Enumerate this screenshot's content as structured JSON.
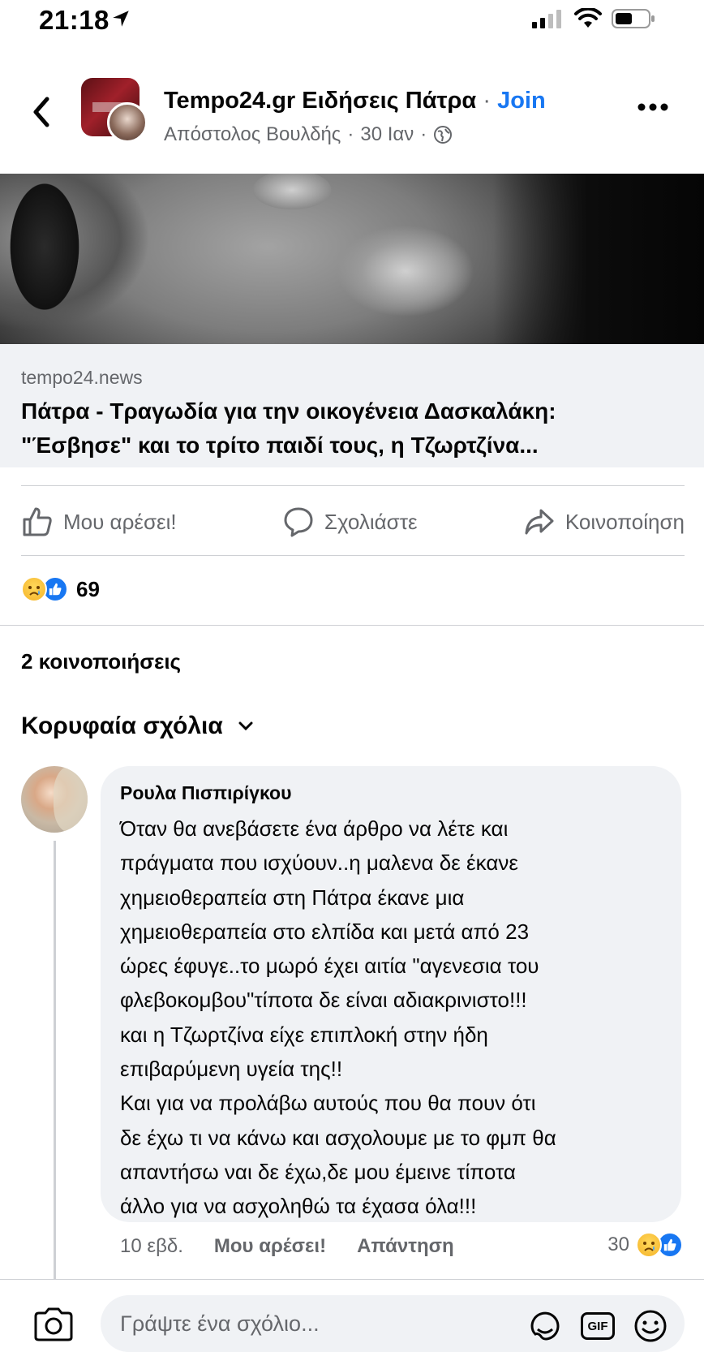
{
  "status_bar": {
    "time": "21:18"
  },
  "header": {
    "group_name": "Tempo24.gr Ειδήσεις Πάτρα",
    "separator": "·",
    "join_label": "Join",
    "author": "Απόστολος Βουλδής",
    "time": "30 Ιαν",
    "meta_separator": "·"
  },
  "link_card": {
    "domain": "tempo24.news",
    "title_line1": "Πάτρα - Τραγωδία για την οικογένεια Δασκαλάκη:",
    "title_line2": "\"Έσβησε\" και το τρίτο παιδί τους, η Τζωρτζίνα..."
  },
  "actions": {
    "like": "Μου αρέσει!",
    "comment": "Σχολιάστε",
    "share": "Κοινοποίηση"
  },
  "reactions": {
    "count": "69"
  },
  "shares_label": "2 κοινοποιήσεις",
  "comments_sort_label": "Κορυφαία σχόλια",
  "comment": {
    "author": "Ρουλα Πισπιρίγκου",
    "lines": [
      "Όταν θα ανεβάσετε ένα άρθρο να λέτε και",
      "πράγματα που ισχύουν..η μαλενα δε έκανε",
      "χημειοθεραπεία στη Πάτρα έκανε μια",
      "χημειοθεραπεία στο ελπίδα και μετά από 23",
      "ώρες έφυγε..το μωρό έχει αιτία \"αγενεσια του",
      "φλεβοκομβου\"τίποτα δε είναι αδιακρινιστο!!!",
      "και η Τζωρτζίνα είχε επιπλοκή στην ήδη",
      "επιβαρύμενη υγεία της!!",
      "Και για να προλάβω αυτούς που θα πουν ότι",
      "δε έχω τι να κάνω και ασχολουμε με το φμπ θα",
      "απαντήσω ναι δε έχω,δε μου έμεινε τίποτα",
      "άλλο για να ασχοληθώ τα έχασα όλα!!!"
    ],
    "age": "10 εβδ.",
    "like_label": "Μου αρέσει!",
    "reply_label": "Απάντηση",
    "reaction_count": "30"
  },
  "compose": {
    "placeholder": "Γράψτε ένα σχόλιο...",
    "gif_label": "GIF"
  },
  "icons": {
    "status": [
      "location-arrow-icon",
      "cellular-signal-icon",
      "wifi-icon",
      "battery-icon"
    ],
    "header": [
      "back-chevron-icon",
      "globe-icon",
      "more-options-icon"
    ],
    "actions": [
      "thumbs-up-icon",
      "comment-bubble-icon",
      "share-arrow-icon"
    ],
    "reactions": [
      "sad-emoji-icon",
      "like-reaction-icon"
    ],
    "compose": [
      "camera-icon",
      "sticker-icon",
      "gif-icon",
      "emoji-icon"
    ]
  },
  "colors": {
    "accent": "#1877f2",
    "secondary_text": "#65676b",
    "bubble": "#f0f2f5",
    "divider": "#ced0d4"
  }
}
